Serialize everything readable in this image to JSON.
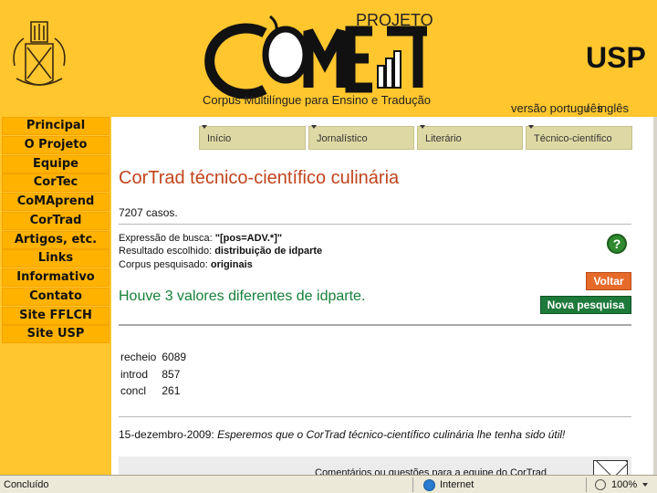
{
  "header": {
    "lang_pt": "versão português",
    "lang_sep": "/",
    "lang_en": "inglês"
  },
  "nav": {
    "items": [
      "Principal",
      "O Projeto",
      "Equipe",
      "CorTec",
      "CoMAprend",
      "CorTrad",
      "Artigos, etc.",
      "Links",
      "Informativo",
      "Contato",
      "Site FFLCH",
      "Site USP"
    ]
  },
  "tabs": {
    "inicio": "Início",
    "jornalistico": "Jornalístico",
    "literario": "Literário",
    "tecnico": "Técnico-científico"
  },
  "main": {
    "title": "CorTrad técnico-científico culinária",
    "cases": "7207 casos.",
    "query": {
      "search_label": "Expressão de busca:",
      "search_value": "\"[pos=ADV.*]\"",
      "result_label": "Resultado escolhido:",
      "result_value": "distribuição de idparte",
      "corpus_label": "Corpus pesquisado:",
      "corpus_value": "originais"
    },
    "help": "?",
    "back_label": "Voltar",
    "new_search_label": "Nova pesquisa",
    "result_heading": "Houve 3 valores diferentes de idparte.",
    "frequencies": [
      {
        "label": "recheio",
        "count": "6089"
      },
      {
        "label": "introd",
        "count": "857"
      },
      {
        "label": "concl",
        "count": "261"
      }
    ],
    "footer_date": "15-dezembro-2009:",
    "footer_message": "Esperemos que o CorTrad técnico-científico culinária lhe tenha sido útil!",
    "comments": "Comentários ou questões para a equipe do CorTrad"
  },
  "statusbar": {
    "status": "Concluído",
    "zone": "Internet",
    "zoom": "100%"
  },
  "colors": {
    "background": "#ffc62e",
    "nav_item": "#ffb200",
    "title": "#c2441c",
    "result_heading": "#17803a",
    "back_button": "#e66a2a",
    "new_search_button": "#1e7a3a"
  }
}
